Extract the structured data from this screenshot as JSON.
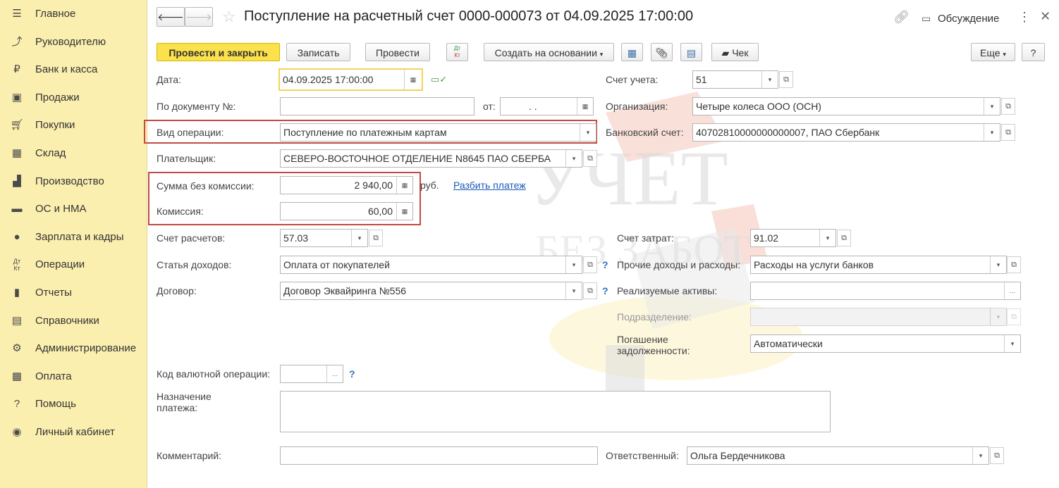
{
  "sidebar": {
    "items": [
      {
        "label": "Главное",
        "icon": "menu-icon"
      },
      {
        "label": "Руководителю",
        "icon": "trend-icon"
      },
      {
        "label": "Банк и касса",
        "icon": "ruble-coin-icon"
      },
      {
        "label": "Продажи",
        "icon": "shopping-bag-icon"
      },
      {
        "label": "Покупки",
        "icon": "cart-icon"
      },
      {
        "label": "Склад",
        "icon": "grid-icon"
      },
      {
        "label": "Производство",
        "icon": "factory-icon"
      },
      {
        "label": "ОС и НМА",
        "icon": "truck-icon"
      },
      {
        "label": "Зарплата и кадры",
        "icon": "person-icon"
      },
      {
        "label": "Операции",
        "icon": "dt-kt-icon"
      },
      {
        "label": "Отчеты",
        "icon": "bar-chart-icon"
      },
      {
        "label": "Справочники",
        "icon": "books-icon"
      },
      {
        "label": "Администрирование",
        "icon": "gear-icon"
      },
      {
        "label": "Оплата",
        "icon": "wallet-icon"
      },
      {
        "label": "Помощь",
        "icon": "question-icon"
      },
      {
        "label": "Личный кабинет",
        "icon": "account-icon"
      }
    ]
  },
  "header": {
    "title": "Поступление на расчетный счет 0000-000073 от 04.09.2025 17:00:00",
    "discussion": "Обсуждение"
  },
  "toolbar": {
    "post_close": "Провести и закрыть",
    "save": "Записать",
    "post": "Провести",
    "dtkt": "Дт Кт",
    "create_based": "Создать на основании",
    "receipt": "Чек",
    "more": "Еще",
    "help": "?"
  },
  "form": {
    "date_label": "Дата:",
    "date_value": "04.09.2025 17:00:00",
    "docnum_label": "По документу №:",
    "docnum_value": "",
    "from_label": "от:",
    "from_value": ". .",
    "optype_label": "Вид операции:",
    "optype_value": "Поступление по платежным картам",
    "payer_label": "Плательщик:",
    "payer_value": "СЕВЕРО-ВОСТОЧНОЕ ОТДЕЛЕНИЕ N8645 ПАО СБЕРБА",
    "sum_label": "Сумма без комиссии:",
    "sum_value": "2 940,00",
    "currency": "руб.",
    "split_link": "Разбить платеж",
    "fee_label": "Комиссия:",
    "fee_value": "60,00",
    "settle_label": "Счет расчетов:",
    "settle_value": "57.03",
    "income_label": "Статья доходов:",
    "income_value": "Оплата от покупателей",
    "contract_label": "Договор:",
    "contract_value": "Договор Эквайринга №556",
    "currency_op_label": "Код валютной операции:",
    "currency_op_value": "",
    "purpose_label": "Назначение платежа:",
    "purpose_value": "",
    "comment_label": "Комментарий:",
    "comment_value": "",
    "account_label": "Счет учета:",
    "account_value": "51",
    "org_label": "Организация:",
    "org_value": "Четыре колеса ООО (ОСН)",
    "bank_label": "Банковский счет:",
    "bank_value": "40702810000000000007, ПАО Сбербанк",
    "cost_label": "Счет затрат:",
    "cost_value": "91.02",
    "other_label": "Прочие доходы и расходы:",
    "other_value": "Расходы на услуги банков",
    "assets_label": "Реализуемые активы:",
    "assets_value": "",
    "dept_label": "Подразделение:",
    "dept_value": "",
    "debt_label": "Погашение задолженности:",
    "debt_value": "Автоматически",
    "resp_label": "Ответственный:",
    "resp_value": "Ольга Бердечникова"
  },
  "watermark": {
    "line1": "УЧЕТ",
    "line2": "БЕЗ ЗАБОТ"
  }
}
